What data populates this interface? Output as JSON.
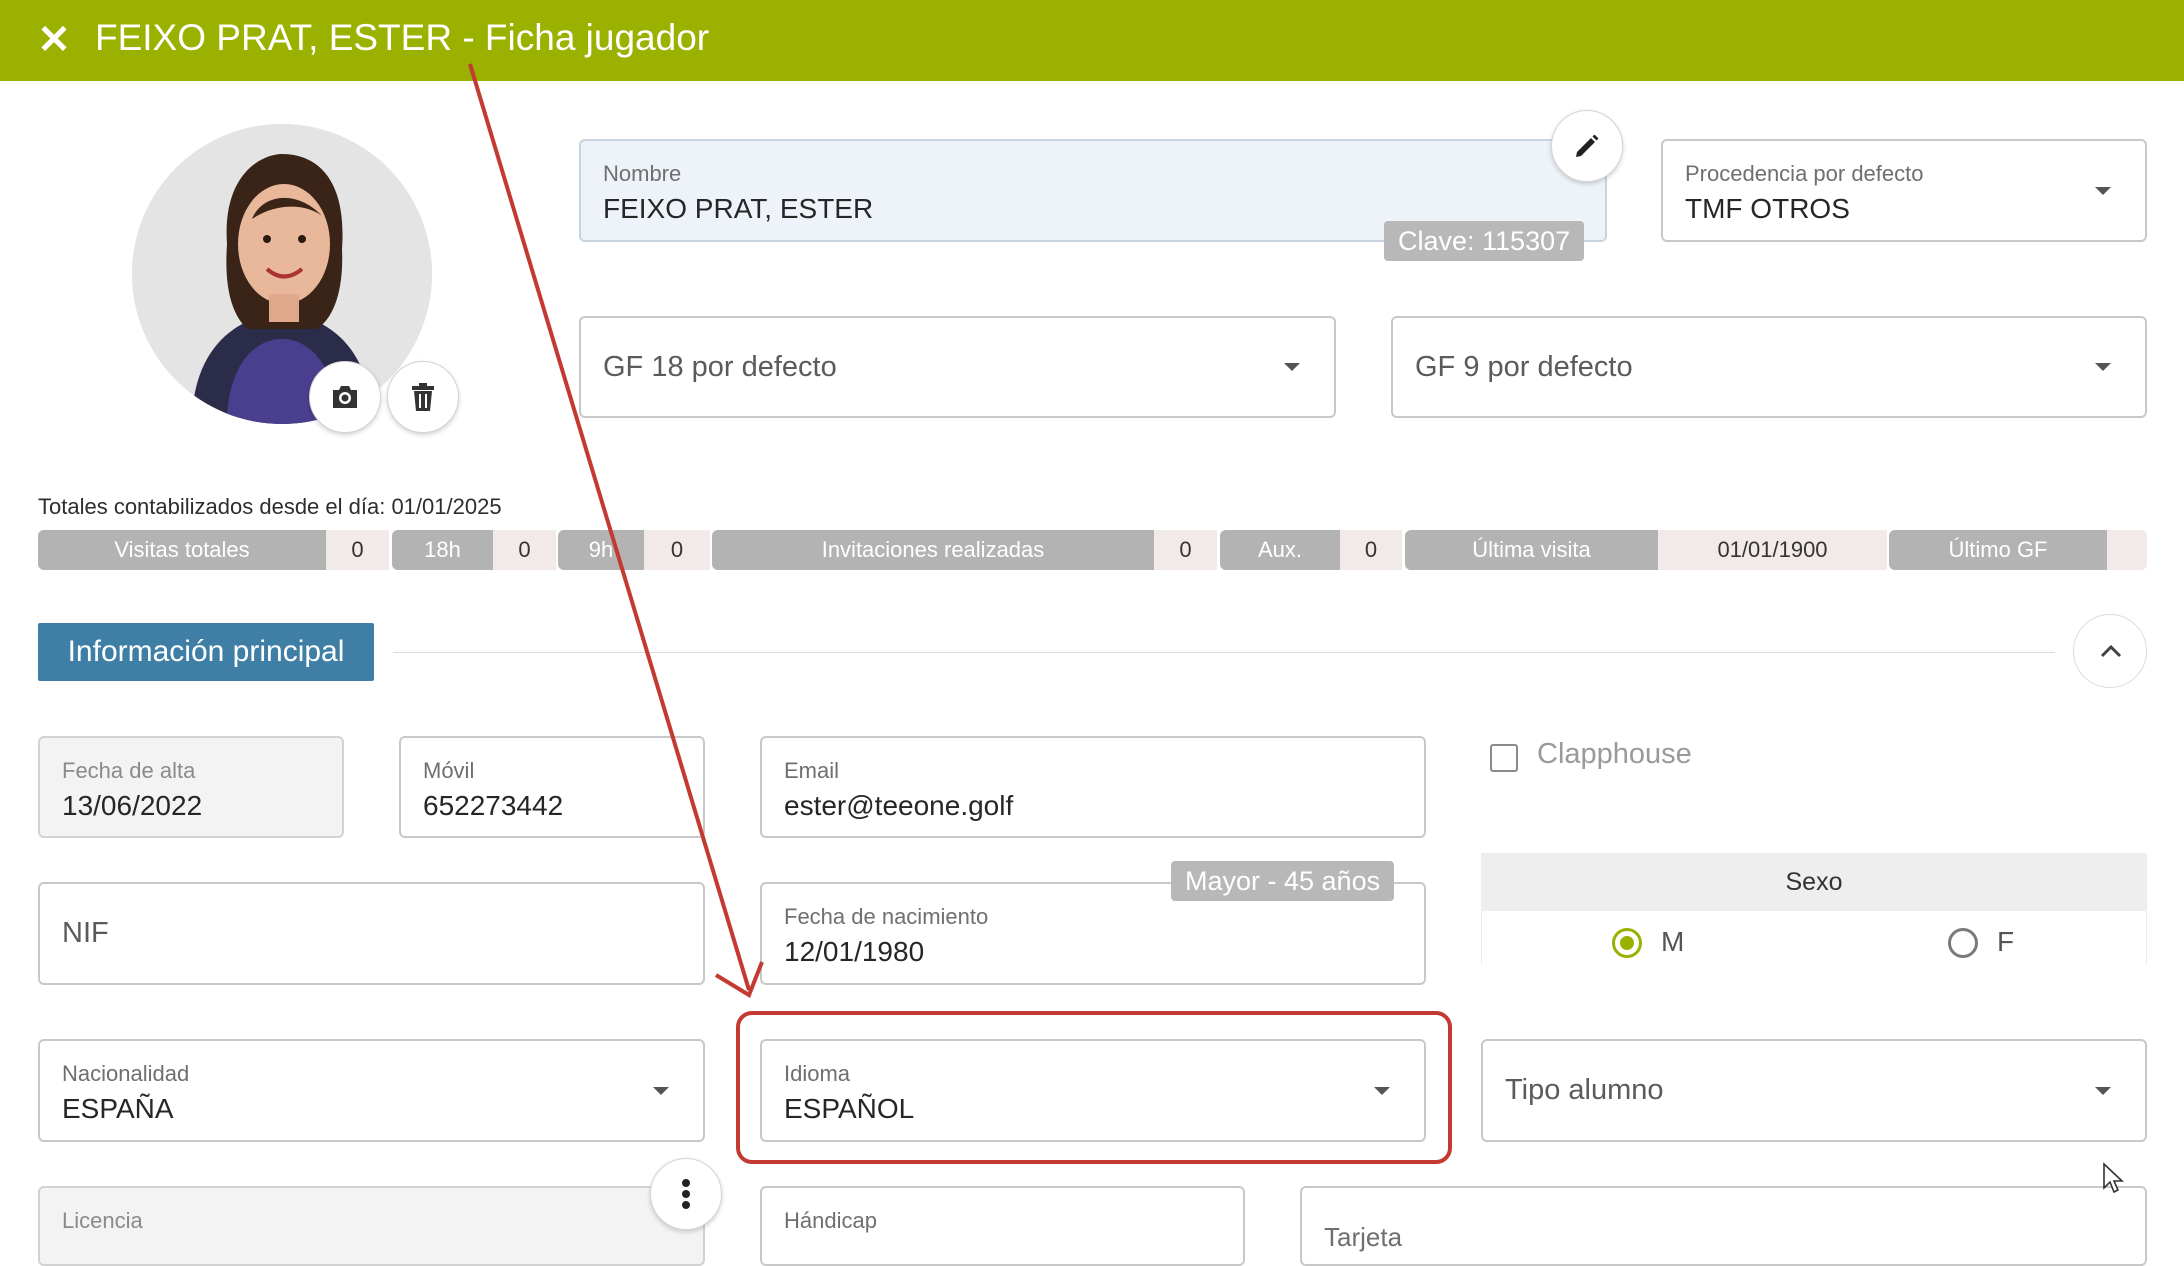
{
  "header": {
    "close_icon": "close-icon",
    "title": "FEIXO PRAT, ESTER - Ficha jugador",
    "color": "#9bb100"
  },
  "profile": {
    "photo_alt": "player-photo",
    "camera_icon": "camera-icon",
    "delete_icon": "trash-icon"
  },
  "name_field": {
    "label": "Nombre",
    "value": "FEIXO PRAT, ESTER",
    "clave": "Clave: 115307",
    "edit_icon": "pencil-icon"
  },
  "procedencia": {
    "label": "Procedencia por defecto",
    "value": "TMF OTROS"
  },
  "gf18": {
    "placeholder": "GF 18 por defecto"
  },
  "gf9": {
    "placeholder": "GF 9 por defecto"
  },
  "totals": {
    "label": "Totales contabilizados desde el día: 01/01/2025",
    "stats": [
      {
        "label": "Visitas totales",
        "value": "0"
      },
      {
        "label": "18h",
        "value": "0"
      },
      {
        "label": "9h",
        "value": "0"
      },
      {
        "label": "Invitaciones realizadas",
        "value": "0"
      },
      {
        "label": "Aux.",
        "value": "0"
      },
      {
        "label": "Última visita",
        "value": "01/01/1900"
      },
      {
        "label": "Último GF",
        "value": ""
      }
    ]
  },
  "section": {
    "title": "Información principal",
    "collapse_icon": "chevron-up-icon",
    "accent": "#3f7fa6"
  },
  "fields": {
    "fecha_alta": {
      "label": "Fecha de alta",
      "value": "13/06/2022"
    },
    "movil": {
      "label": "Móvil",
      "value": "652273442"
    },
    "email": {
      "label": "Email",
      "value": "ester@teeone.golf"
    },
    "clapphouse": {
      "label": "Clapphouse",
      "checked": false
    },
    "nif": {
      "placeholder": "NIF"
    },
    "fecha_nacimiento": {
      "label": "Fecha de nacimiento",
      "value": "12/01/1980",
      "age_badge": "Mayor - 45 años"
    },
    "sexo": {
      "label": "Sexo",
      "options": [
        "M",
        "F"
      ],
      "selected": "M"
    },
    "nacionalidad": {
      "label": "Nacionalidad",
      "value": "ESPAÑA"
    },
    "idioma": {
      "label": "Idioma",
      "value": "ESPAÑOL"
    },
    "tipo_alumno": {
      "placeholder": "Tipo alumno"
    },
    "licencia": {
      "label": "Licencia"
    },
    "handicap": {
      "label": "Hándicap"
    },
    "tarjeta": {
      "label": "Tarjeta"
    }
  },
  "annotation": {
    "color": "#c23a32"
  }
}
